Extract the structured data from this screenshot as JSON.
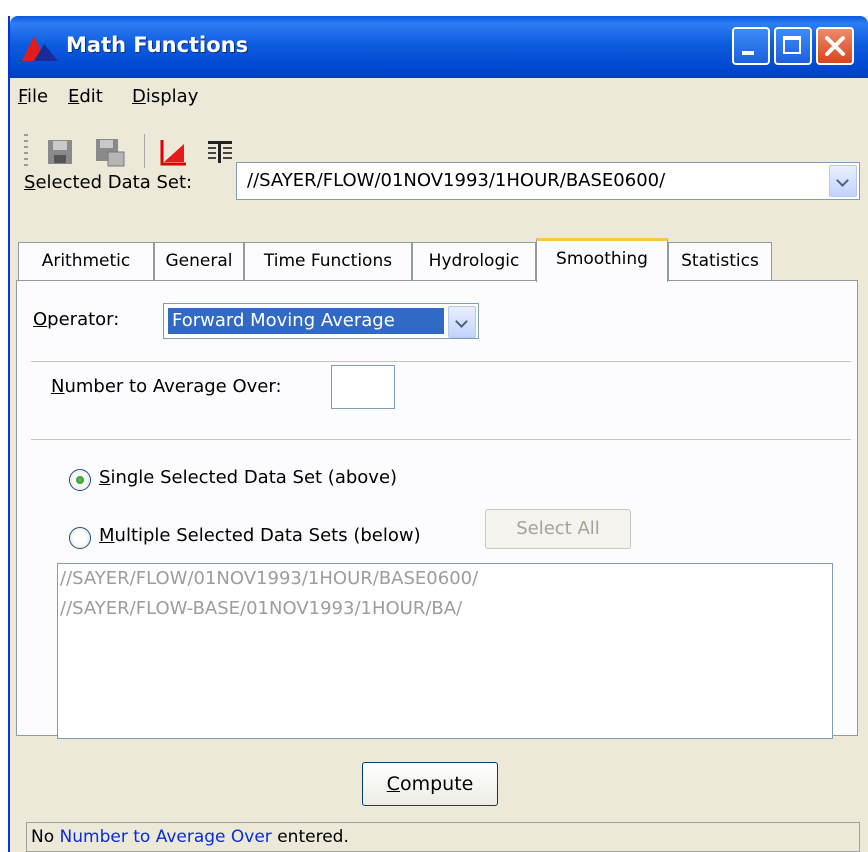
{
  "window": {
    "title": "Math Functions",
    "controls": [
      "minimize-icon",
      "maximize-icon",
      "close-icon"
    ]
  },
  "menu": [
    {
      "label": "File",
      "mnemonic": "F",
      "rest": "ile"
    },
    {
      "label": "Edit",
      "mnemonic": "E",
      "rest": "dit"
    },
    {
      "label": "Display",
      "mnemonic": "D",
      "rest": "isplay"
    }
  ],
  "toolbar": {
    "icons": [
      "save-icon",
      "save-as-icon",
      "plot-icon",
      "table-icon"
    ]
  },
  "dataset": {
    "label_mnemonic": "S",
    "label_rest": "elected Data Set:",
    "value": "//SAYER/FLOW/01NOV1993/1HOUR/BASE0600/"
  },
  "tabs": [
    {
      "label": "Arithmetic",
      "active": false
    },
    {
      "label": "General",
      "active": false
    },
    {
      "label": "Time Functions",
      "active": false
    },
    {
      "label": "Hydrologic",
      "active": false
    },
    {
      "label": "Smoothing",
      "active": true
    },
    {
      "label": "Statistics",
      "active": false
    }
  ],
  "smoothing": {
    "operator_label_mnemonic": "O",
    "operator_label_rest": "perator:",
    "operator_value": "Forward Moving Average",
    "number_label_mnemonic": "N",
    "number_label_rest": "umber to Average Over:",
    "number_value": "",
    "radio_single_mnemonic": "S",
    "radio_single_rest": "ingle Selected Data Set (above)",
    "radio_single_checked": true,
    "radio_multiple_mnemonic": "M",
    "radio_multiple_rest": "ultiple Selected Data Sets (below)",
    "radio_multiple_checked": false,
    "select_all_label": "Select All",
    "datasets": [
      "//SAYER/FLOW/01NOV1993/1HOUR/BASE0600/",
      "//SAYER/FLOW-BASE/01NOV1993/1HOUR/BA/"
    ]
  },
  "compute": {
    "mnemonic": "C",
    "rest": "ompute"
  },
  "status": {
    "prefix": "No ",
    "highlight": "Number to Average Over",
    "suffix": " entered."
  },
  "colors": {
    "titlebar": "#0054e3",
    "accent_tab": "#ffc83c",
    "selection": "#316ac5",
    "status_link": "#0a2bd8"
  }
}
